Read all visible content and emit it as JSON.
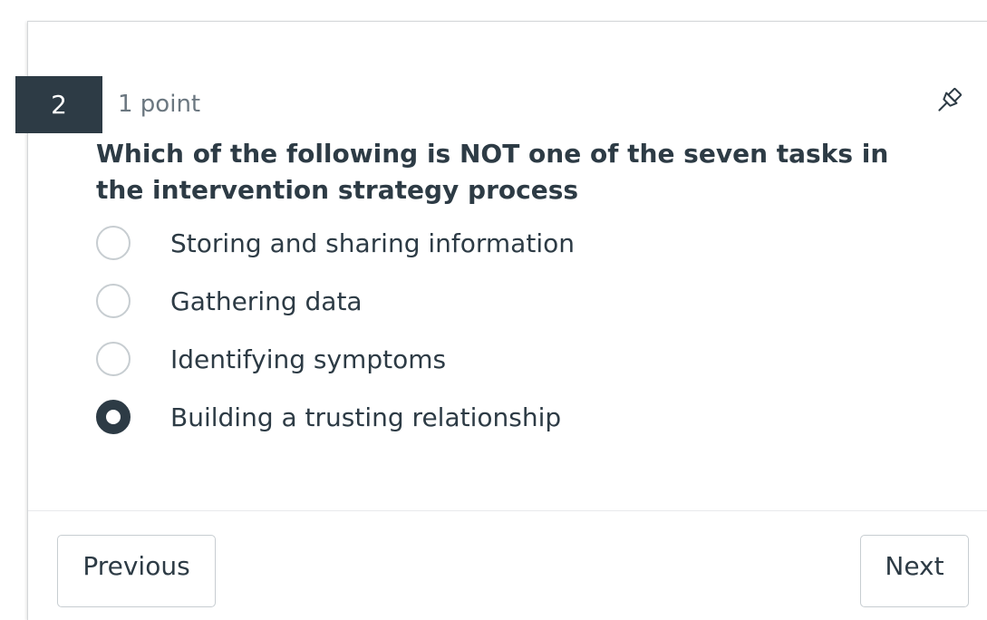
{
  "question": {
    "number": "2",
    "points": "1 point",
    "text": "Which of the following is NOT one of the seven tasks in the intervention strategy process"
  },
  "answers": [
    {
      "label": "Storing and sharing information",
      "selected": false
    },
    {
      "label": "Gathering data",
      "selected": false
    },
    {
      "label": "Identifying symptoms",
      "selected": false
    },
    {
      "label": "Building a trusting relationship",
      "selected": true
    }
  ],
  "navigation": {
    "previous_label": "Previous",
    "next_label": "Next"
  },
  "icons": {
    "pin": "pin-icon"
  },
  "colors": {
    "primary_dark": "#2d3b45",
    "muted_text": "#6b7780",
    "border": "#c7cdd1"
  }
}
